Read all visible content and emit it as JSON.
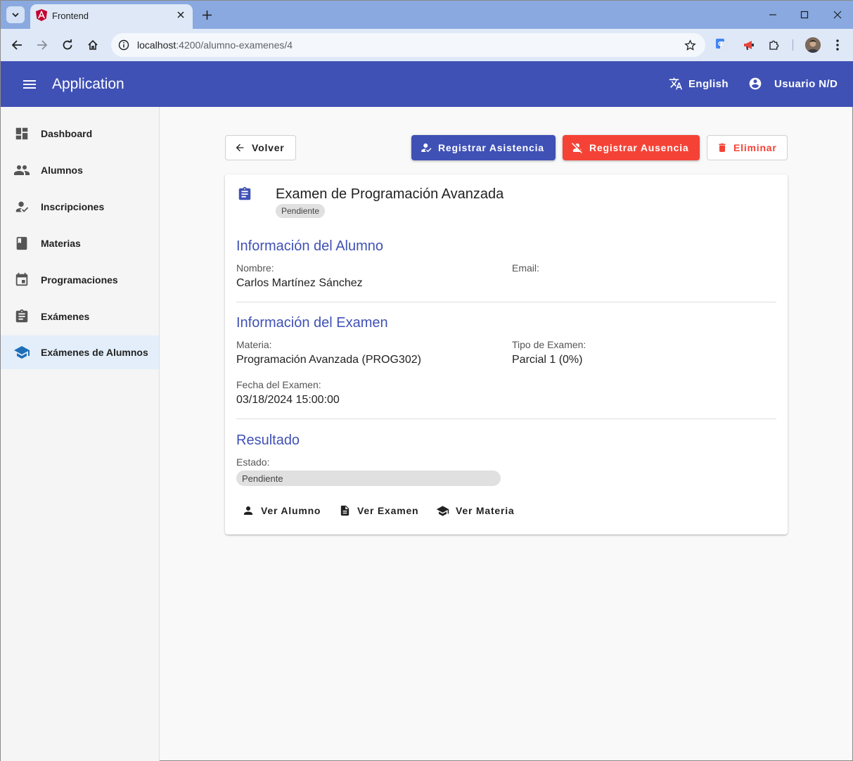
{
  "browser": {
    "tab_title": "Frontend",
    "url_host": "localhost",
    "url_path": ":4200/alumno-examenes/4"
  },
  "appbar": {
    "title": "Application",
    "language": "English",
    "user": "Usuario N/D"
  },
  "sidebar": {
    "items": [
      {
        "label": "Dashboard",
        "icon": "dashboard-icon"
      },
      {
        "label": "Alumnos",
        "icon": "people-icon"
      },
      {
        "label": "Inscripciones",
        "icon": "how-to-reg-icon"
      },
      {
        "label": "Materias",
        "icon": "book-icon"
      },
      {
        "label": "Programaciones",
        "icon": "event-icon"
      },
      {
        "label": "Exámenes",
        "icon": "assignment-icon"
      },
      {
        "label": "Exámenes de Alumnos",
        "icon": "school-icon",
        "active": true
      }
    ]
  },
  "actions": {
    "back": "Volver",
    "register_attendance": "Registrar Asistencia",
    "register_absence": "Registrar Ausencia",
    "delete": "Eliminar"
  },
  "card": {
    "title": "Examen de Programación Avanzada",
    "status_chip": "Pendiente",
    "student_section": {
      "title": "Información del Alumno",
      "name_label": "Nombre:",
      "name_value": "Carlos Martínez Sánchez",
      "email_label": "Email:",
      "email_value": ""
    },
    "exam_section": {
      "title": "Información del Examen",
      "subject_label": "Materia:",
      "subject_value": "Programación Avanzada (PROG302)",
      "type_label": "Tipo de Examen:",
      "type_value": "Parcial 1 (0%)",
      "date_label": "Fecha del Examen:",
      "date_value": "03/18/2024 15:00:00"
    },
    "result_section": {
      "title": "Resultado",
      "state_label": "Estado:",
      "state_value": "Pendiente"
    },
    "links": {
      "view_student": "Ver Alumno",
      "view_exam": "Ver Examen",
      "view_subject": "Ver Materia"
    }
  },
  "colors": {
    "primary": "#3f51b5",
    "warn": "#f44336",
    "active_nav_bg": "#e3eefa"
  }
}
